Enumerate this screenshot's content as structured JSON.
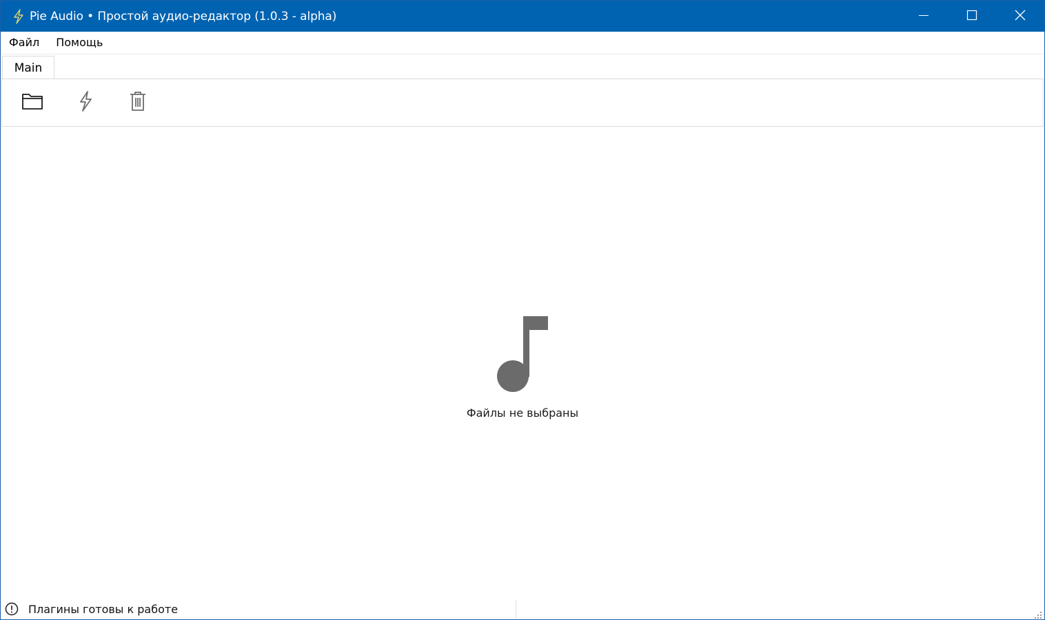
{
  "window": {
    "title": "Pie Audio • Простой аудио-редактор (1.0.3 - alpha)",
    "app_icon": "lightning-icon",
    "controls": [
      "minimize-icon",
      "maximize-icon",
      "close-icon"
    ]
  },
  "menu": {
    "items": [
      {
        "label": "Файл"
      },
      {
        "label": "Помощь"
      }
    ]
  },
  "tabs": [
    {
      "label": "Main",
      "active": true
    }
  ],
  "toolbar": {
    "buttons": [
      {
        "icon": "folder-open-icon"
      },
      {
        "icon": "lightning-icon"
      },
      {
        "icon": "trash-icon"
      }
    ]
  },
  "content": {
    "empty_icon": "music-note-icon",
    "empty_message": "Файлы не выбраны"
  },
  "status": {
    "icon": "alert-circle-icon",
    "text": "Плагины готовы к работе"
  },
  "colors": {
    "titlebar": "#0063b1",
    "icon_gray": "#6b6b6b",
    "lightning_yellow": "#e8d36a"
  }
}
